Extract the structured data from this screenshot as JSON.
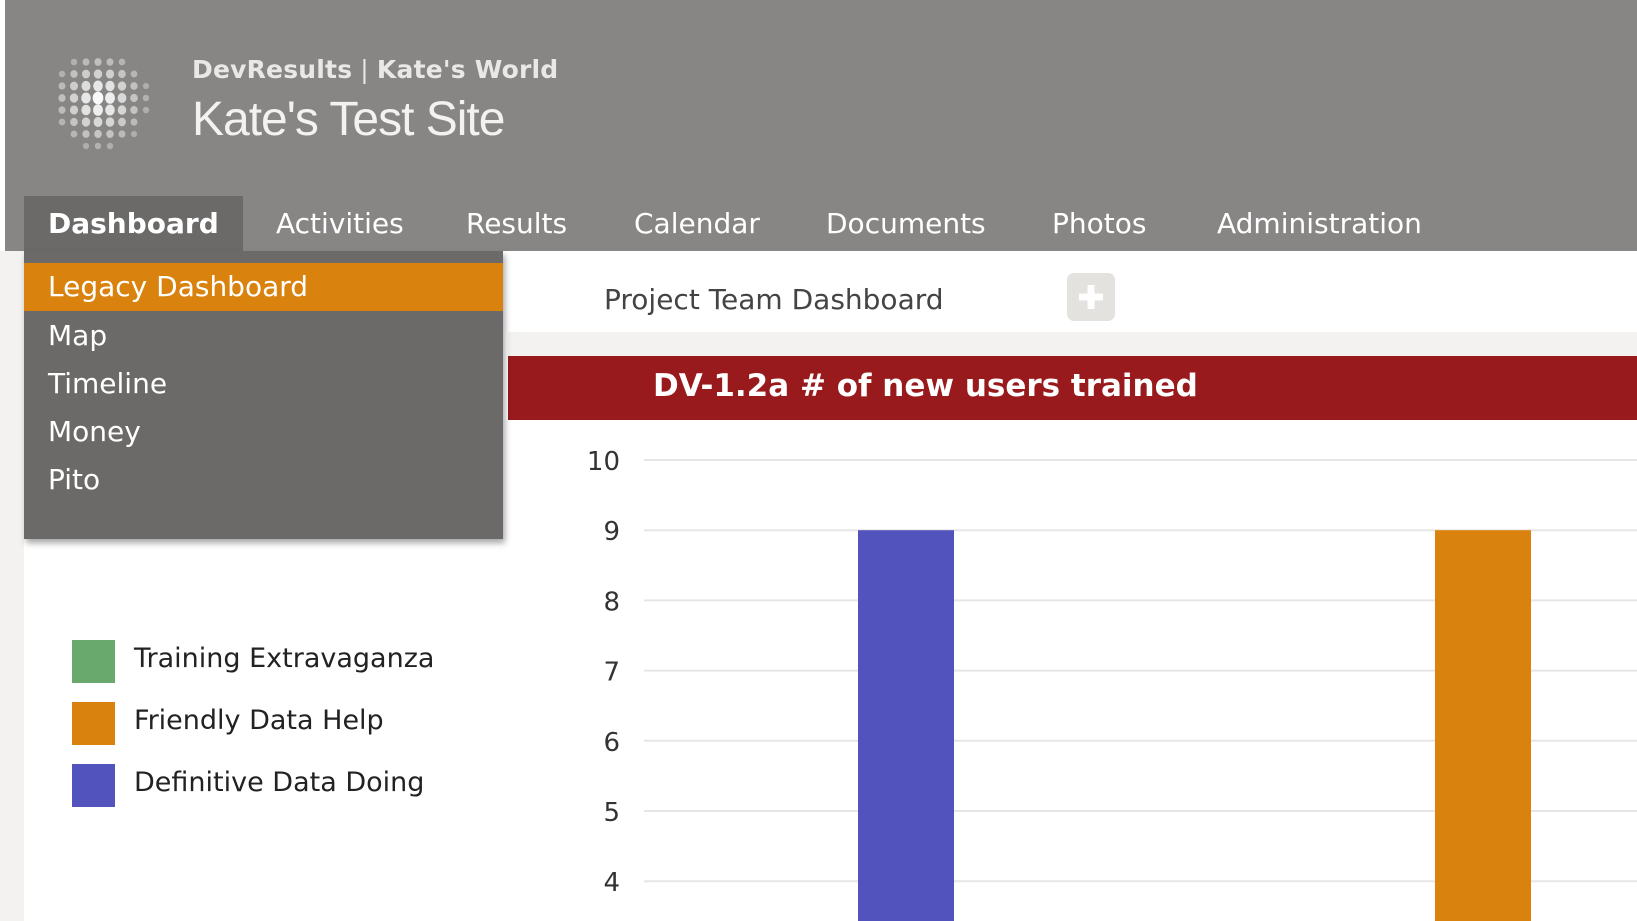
{
  "header": {
    "brand": "DevResults",
    "separator": "|",
    "workspace": "Kate's World",
    "site_title": "Kate's Test Site"
  },
  "nav": {
    "tabs": [
      {
        "label": "Dashboard",
        "active": true
      },
      {
        "label": "Activities"
      },
      {
        "label": "Results"
      },
      {
        "label": "Calendar"
      },
      {
        "label": "Documents"
      },
      {
        "label": "Photos"
      },
      {
        "label": "Administration"
      }
    ]
  },
  "dropdown": {
    "items": [
      {
        "label": "Legacy Dashboard",
        "highlighted": true
      },
      {
        "label": "Map"
      },
      {
        "label": "Timeline"
      },
      {
        "label": "Money"
      },
      {
        "label": "Pito"
      }
    ]
  },
  "dashboard_tabs": {
    "project_team": "Project Team Dashboard",
    "add_icon": "plus-icon"
  },
  "legend": {
    "items": [
      {
        "label": "Training Extravaganza",
        "color": "#6aa96e"
      },
      {
        "label": "Friendly Data Help",
        "color": "#d9820d"
      },
      {
        "label": "Definitive Data Doing",
        "color": "#5353bd"
      }
    ]
  },
  "colors": {
    "header_bg": "#878685",
    "menu_bg": "#6b6a69",
    "accent_orange": "#d9820d",
    "banner_red": "#981a1c"
  },
  "chart_data": {
    "type": "bar",
    "title": "DV-1.2a # of new users trained",
    "y_ticks": [
      "10",
      "9",
      "8",
      "7",
      "6",
      "5",
      "4"
    ],
    "visible_y_range": [
      4,
      10
    ],
    "grid": true,
    "series": [
      {
        "name": "Definitive Data Doing",
        "color": "#5353bd",
        "values": [
          9
        ]
      },
      {
        "name": "Friendly Data Help",
        "color": "#d9820d",
        "values": [
          9
        ]
      }
    ]
  }
}
